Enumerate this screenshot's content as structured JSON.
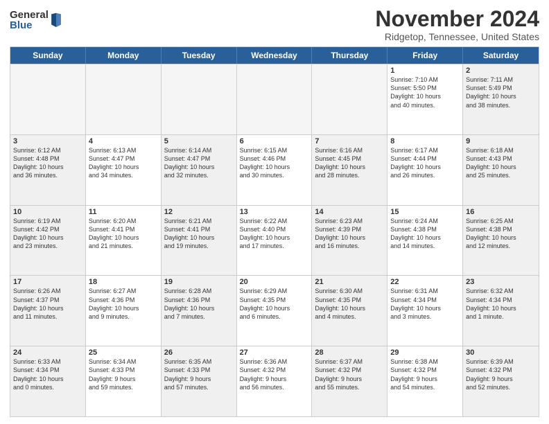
{
  "logo": {
    "general": "General",
    "blue": "Blue"
  },
  "title": "November 2024",
  "location": "Ridgetop, Tennessee, United States",
  "days_of_week": [
    "Sunday",
    "Monday",
    "Tuesday",
    "Wednesday",
    "Thursday",
    "Friday",
    "Saturday"
  ],
  "weeks": [
    [
      {
        "day": "",
        "info": "",
        "empty": true
      },
      {
        "day": "",
        "info": "",
        "empty": true
      },
      {
        "day": "",
        "info": "",
        "empty": true
      },
      {
        "day": "",
        "info": "",
        "empty": true
      },
      {
        "day": "",
        "info": "",
        "empty": true
      },
      {
        "day": "1",
        "info": "Sunrise: 7:10 AM\nSunset: 5:50 PM\nDaylight: 10 hours\nand 40 minutes."
      },
      {
        "day": "2",
        "info": "Sunrise: 7:11 AM\nSunset: 5:49 PM\nDaylight: 10 hours\nand 38 minutes.",
        "shaded": true
      }
    ],
    [
      {
        "day": "3",
        "info": "Sunrise: 6:12 AM\nSunset: 4:48 PM\nDaylight: 10 hours\nand 36 minutes.",
        "shaded": true
      },
      {
        "day": "4",
        "info": "Sunrise: 6:13 AM\nSunset: 4:47 PM\nDaylight: 10 hours\nand 34 minutes."
      },
      {
        "day": "5",
        "info": "Sunrise: 6:14 AM\nSunset: 4:47 PM\nDaylight: 10 hours\nand 32 minutes.",
        "shaded": true
      },
      {
        "day": "6",
        "info": "Sunrise: 6:15 AM\nSunset: 4:46 PM\nDaylight: 10 hours\nand 30 minutes."
      },
      {
        "day": "7",
        "info": "Sunrise: 6:16 AM\nSunset: 4:45 PM\nDaylight: 10 hours\nand 28 minutes.",
        "shaded": true
      },
      {
        "day": "8",
        "info": "Sunrise: 6:17 AM\nSunset: 4:44 PM\nDaylight: 10 hours\nand 26 minutes."
      },
      {
        "day": "9",
        "info": "Sunrise: 6:18 AM\nSunset: 4:43 PM\nDaylight: 10 hours\nand 25 minutes.",
        "shaded": true
      }
    ],
    [
      {
        "day": "10",
        "info": "Sunrise: 6:19 AM\nSunset: 4:42 PM\nDaylight: 10 hours\nand 23 minutes.",
        "shaded": true
      },
      {
        "day": "11",
        "info": "Sunrise: 6:20 AM\nSunset: 4:41 PM\nDaylight: 10 hours\nand 21 minutes."
      },
      {
        "day": "12",
        "info": "Sunrise: 6:21 AM\nSunset: 4:41 PM\nDaylight: 10 hours\nand 19 minutes.",
        "shaded": true
      },
      {
        "day": "13",
        "info": "Sunrise: 6:22 AM\nSunset: 4:40 PM\nDaylight: 10 hours\nand 17 minutes."
      },
      {
        "day": "14",
        "info": "Sunrise: 6:23 AM\nSunset: 4:39 PM\nDaylight: 10 hours\nand 16 minutes.",
        "shaded": true
      },
      {
        "day": "15",
        "info": "Sunrise: 6:24 AM\nSunset: 4:38 PM\nDaylight: 10 hours\nand 14 minutes."
      },
      {
        "day": "16",
        "info": "Sunrise: 6:25 AM\nSunset: 4:38 PM\nDaylight: 10 hours\nand 12 minutes.",
        "shaded": true
      }
    ],
    [
      {
        "day": "17",
        "info": "Sunrise: 6:26 AM\nSunset: 4:37 PM\nDaylight: 10 hours\nand 11 minutes.",
        "shaded": true
      },
      {
        "day": "18",
        "info": "Sunrise: 6:27 AM\nSunset: 4:36 PM\nDaylight: 10 hours\nand 9 minutes."
      },
      {
        "day": "19",
        "info": "Sunrise: 6:28 AM\nSunset: 4:36 PM\nDaylight: 10 hours\nand 7 minutes.",
        "shaded": true
      },
      {
        "day": "20",
        "info": "Sunrise: 6:29 AM\nSunset: 4:35 PM\nDaylight: 10 hours\nand 6 minutes."
      },
      {
        "day": "21",
        "info": "Sunrise: 6:30 AM\nSunset: 4:35 PM\nDaylight: 10 hours\nand 4 minutes.",
        "shaded": true
      },
      {
        "day": "22",
        "info": "Sunrise: 6:31 AM\nSunset: 4:34 PM\nDaylight: 10 hours\nand 3 minutes."
      },
      {
        "day": "23",
        "info": "Sunrise: 6:32 AM\nSunset: 4:34 PM\nDaylight: 10 hours\nand 1 minute.",
        "shaded": true
      }
    ],
    [
      {
        "day": "24",
        "info": "Sunrise: 6:33 AM\nSunset: 4:34 PM\nDaylight: 10 hours\nand 0 minutes.",
        "shaded": true
      },
      {
        "day": "25",
        "info": "Sunrise: 6:34 AM\nSunset: 4:33 PM\nDaylight: 9 hours\nand 59 minutes."
      },
      {
        "day": "26",
        "info": "Sunrise: 6:35 AM\nSunset: 4:33 PM\nDaylight: 9 hours\nand 57 minutes.",
        "shaded": true
      },
      {
        "day": "27",
        "info": "Sunrise: 6:36 AM\nSunset: 4:32 PM\nDaylight: 9 hours\nand 56 minutes."
      },
      {
        "day": "28",
        "info": "Sunrise: 6:37 AM\nSunset: 4:32 PM\nDaylight: 9 hours\nand 55 minutes.",
        "shaded": true
      },
      {
        "day": "29",
        "info": "Sunrise: 6:38 AM\nSunset: 4:32 PM\nDaylight: 9 hours\nand 54 minutes."
      },
      {
        "day": "30",
        "info": "Sunrise: 6:39 AM\nSunset: 4:32 PM\nDaylight: 9 hours\nand 52 minutes.",
        "shaded": true
      }
    ]
  ]
}
